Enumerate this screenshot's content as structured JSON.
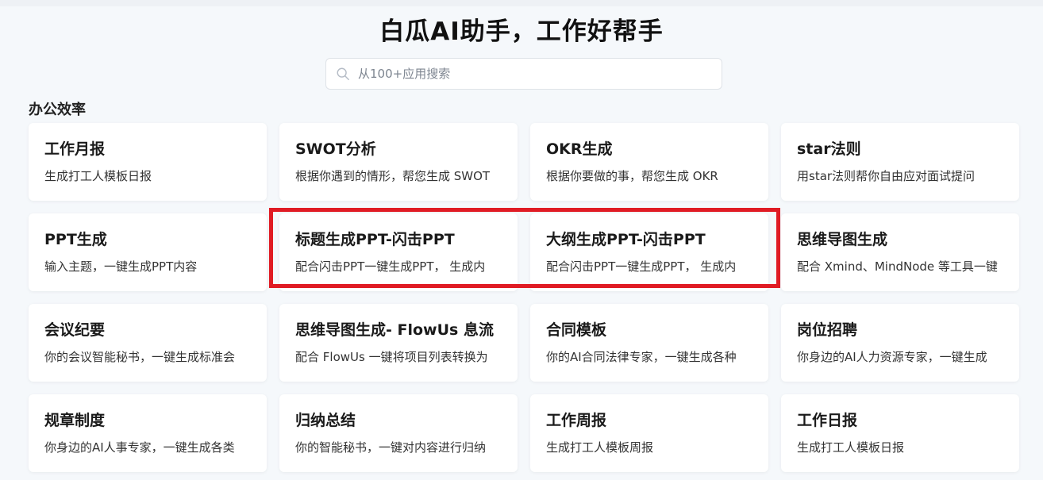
{
  "header": {
    "title": "白瓜AI助手，工作好帮手"
  },
  "search": {
    "placeholder": "从100+应用搜索",
    "value": ""
  },
  "section": {
    "title": "办公效率"
  },
  "cards": [
    {
      "title": "工作月报",
      "desc": "生成打工人模板日报"
    },
    {
      "title": "SWOT分析",
      "desc": "根据你遇到的情形，帮您生成 SWOT"
    },
    {
      "title": "OKR生成",
      "desc": "根据你要做的事，帮您生成 OKR"
    },
    {
      "title": "star法则",
      "desc": "用star法则帮你自由应对面试提问"
    },
    {
      "title": "PPT生成",
      "desc": "输入主题，一键生成PPT内容"
    },
    {
      "title": "标题生成PPT-闪击PPT",
      "desc": "配合闪击PPT一键生成PPT， 生成内"
    },
    {
      "title": "大纲生成PPT-闪击PPT",
      "desc": "配合闪击PPT一键生成PPT， 生成内"
    },
    {
      "title": "思维导图生成",
      "desc": "配合 Xmind、MindNode 等工具一键"
    },
    {
      "title": "会议纪要",
      "desc": "你的会议智能秘书，一键生成标准会"
    },
    {
      "title": "思维导图生成- FlowUs 息流",
      "desc": "配合 FlowUs 一键将项目列表转换为"
    },
    {
      "title": "合同模板",
      "desc": "你的AI合同法律专家，一键生成各种"
    },
    {
      "title": "岗位招聘",
      "desc": "你身边的AI人力资源专家，一键生成"
    },
    {
      "title": "规章制度",
      "desc": "你身边的AI人事专家，一键生成各类"
    },
    {
      "title": "归纳总结",
      "desc": "你的智能秘书，一键对内容进行归纳"
    },
    {
      "title": "工作周报",
      "desc": "生成打工人模板周报"
    },
    {
      "title": "工作日报",
      "desc": "生成打工人模板日报"
    }
  ],
  "colors": {
    "highlight": "#e01b24",
    "background": "#f5f8fb"
  },
  "icons": {
    "search": "search-icon"
  }
}
